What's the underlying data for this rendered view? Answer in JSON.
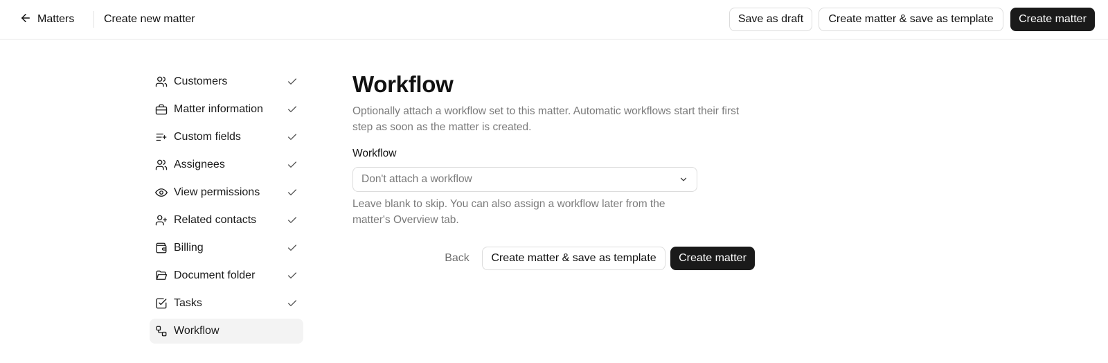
{
  "header": {
    "back_label": "Matters",
    "title": "Create new matter",
    "save_draft_label": "Save as draft",
    "save_template_label": "Create matter & save as template",
    "create_label": "Create matter"
  },
  "sidebar": {
    "items": [
      {
        "label": "Customers",
        "icon": "users-icon",
        "completed": true
      },
      {
        "label": "Matter information",
        "icon": "briefcase-icon",
        "completed": true
      },
      {
        "label": "Custom fields",
        "icon": "list-plus-icon",
        "completed": true
      },
      {
        "label": "Assignees",
        "icon": "users-icon",
        "completed": true
      },
      {
        "label": "View permissions",
        "icon": "eye-icon",
        "completed": true
      },
      {
        "label": "Related contacts",
        "icon": "user-plus-icon",
        "completed": true
      },
      {
        "label": "Billing",
        "icon": "wallet-icon",
        "completed": true
      },
      {
        "label": "Document folder",
        "icon": "folder-open-icon",
        "completed": true
      },
      {
        "label": "Tasks",
        "icon": "square-check-icon",
        "completed": true
      },
      {
        "label": "Workflow",
        "icon": "workflow-icon",
        "completed": false,
        "active": true
      }
    ]
  },
  "main": {
    "title": "Workflow",
    "description": "Optionally attach a workflow set to this matter. Automatic workflows start their first step as soon as the matter is created.",
    "field_label": "Workflow",
    "select_value": "Don't attach a workflow",
    "helper": "Leave blank to skip. You can also assign a workflow later from the matter's Overview tab.",
    "back_label": "Back",
    "save_template_label": "Create matter & save as template",
    "create_label": "Create matter"
  },
  "colors": {
    "primary_button": "#1a1a1a",
    "muted_text": "#7a7a7a",
    "active_item_bg": "#f3f3f3",
    "border": "#dcdcdc"
  }
}
